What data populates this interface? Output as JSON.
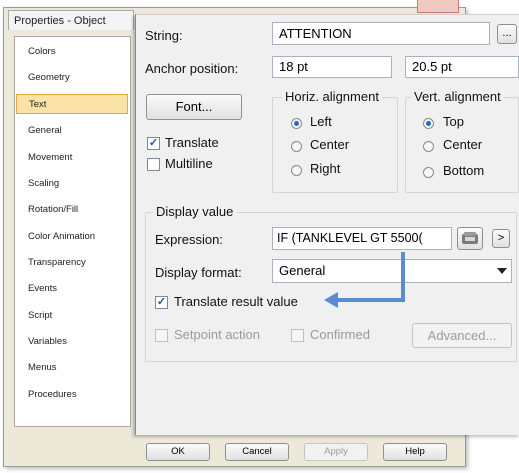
{
  "window": {
    "title": "Properties - Object"
  },
  "sidebar": {
    "items": [
      {
        "label": "Colors"
      },
      {
        "label": "Geometry"
      },
      {
        "label": "Text"
      },
      {
        "label": "General"
      },
      {
        "label": "Movement"
      },
      {
        "label": "Scaling"
      },
      {
        "label": "Rotation/Fill"
      },
      {
        "label": "Color Animation"
      },
      {
        "label": "Transparency"
      },
      {
        "label": "Events"
      },
      {
        "label": "Script"
      },
      {
        "label": "Variables"
      },
      {
        "label": "Menus"
      },
      {
        "label": "Procedures"
      }
    ],
    "selected": "Text"
  },
  "text_panel": {
    "string_label": "String:",
    "string_value": "ATTENTION",
    "string_more": "...",
    "anchor_label": "Anchor position:",
    "anchor_x": "18 pt",
    "anchor_y": "20.5 pt",
    "font_button": "Font...",
    "translate_label": "Translate",
    "translate_checked": true,
    "multiline_label": "Multiline",
    "multiline_checked": false,
    "horiz_title": "Horiz. alignment",
    "horiz_options": [
      "Left",
      "Center",
      "Right"
    ],
    "horiz_selected": "Left",
    "vert_title": "Vert. alignment",
    "vert_options": [
      "Top",
      "Center",
      "Bottom"
    ],
    "vert_selected": "Top"
  },
  "display_value": {
    "title": "Display value",
    "expression_label": "Expression:",
    "expression_value": "IF (TANKLEVEL GT 5500(",
    "format_label": "Display format:",
    "format_value": "General",
    "translate_result_label": "Translate result value",
    "translate_result_checked": true,
    "setpoint_label": "Setpoint action",
    "confirmed_label": "Confirmed",
    "advanced_button": "Advanced..."
  },
  "footer": {
    "ok": "OK",
    "cancel": "Cancel",
    "apply": "Apply",
    "help": "Help"
  },
  "colors": {
    "arrow": "#5b8ccf",
    "selected_bg": "#fbe3a8",
    "accent": "#2469c4"
  }
}
